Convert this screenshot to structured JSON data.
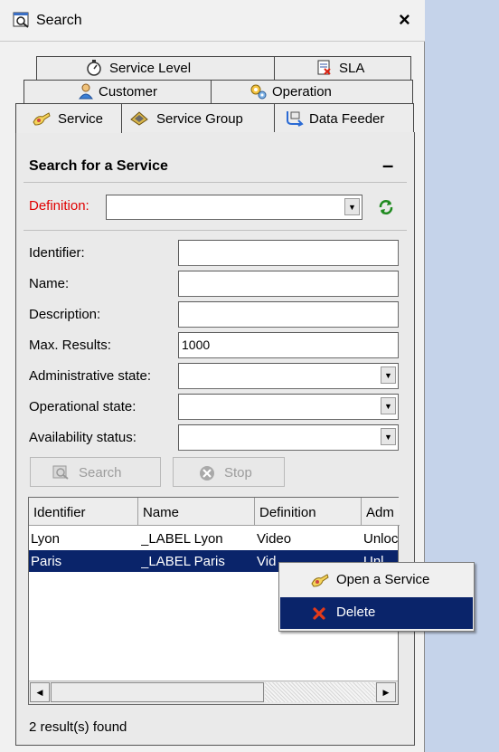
{
  "window": {
    "title": "Search",
    "close_glyph": "×"
  },
  "tabs": {
    "row1": [
      {
        "label": "Service Level",
        "icon": "stopwatch-icon"
      },
      {
        "label": "SLA",
        "icon": "sla-document-icon"
      }
    ],
    "row2": [
      {
        "label": "Customer",
        "icon": "person-icon"
      },
      {
        "label": "Operation",
        "icon": "gears-icon"
      }
    ],
    "row3": [
      {
        "label": "Service",
        "icon": "service-hand-icon"
      },
      {
        "label": "Service Group",
        "icon": "service-group-icon"
      },
      {
        "label": "Data Feeder",
        "icon": "data-feeder-icon"
      }
    ]
  },
  "section": {
    "title": "Search for a Service",
    "collapse_glyph": "–"
  },
  "definition": {
    "label": "Definition:",
    "value": ""
  },
  "fields": [
    {
      "label": "Identifier:",
      "value": ""
    },
    {
      "label": "Name:",
      "value": ""
    },
    {
      "label": "Description:",
      "value": ""
    },
    {
      "label": "Max. Results:",
      "value": "1000"
    }
  ],
  "selects": [
    {
      "label": "Administrative state:",
      "value": ""
    },
    {
      "label": "Operational state:",
      "value": ""
    },
    {
      "label": "Availability status:",
      "value": ""
    }
  ],
  "buttons": {
    "search": "Search",
    "stop": "Stop"
  },
  "table": {
    "columns": [
      "Identifier",
      "Name",
      "Definition",
      "Adm"
    ],
    "rows": [
      [
        "Lyon",
        "_LABEL Lyon",
        "Video",
        "Unloc"
      ],
      [
        "Paris",
        "_LABEL Paris",
        "Vid",
        "Unl"
      ]
    ]
  },
  "context_menu": {
    "items": [
      "Open a Service",
      "Delete"
    ]
  },
  "status": "2 result(s) found",
  "colors": {
    "selection": "#0a246a",
    "required_label": "#e00000",
    "refresh_green": "#1f8a1f"
  }
}
